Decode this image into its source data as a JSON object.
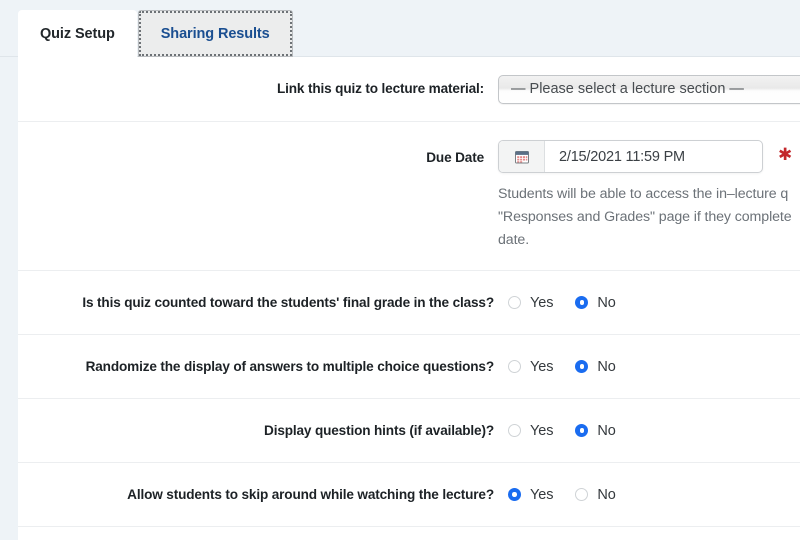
{
  "tabs": [
    {
      "label": "Quiz Setup",
      "active": false
    },
    {
      "label": "Sharing Results",
      "active": true
    }
  ],
  "form": {
    "lecture_link": {
      "label": "Link this quiz to lecture material:",
      "selected_option": "— Please select a lecture section —"
    },
    "due_date": {
      "label": "Due Date",
      "value": "2/15/2021 11:59 PM",
      "placeholder": "",
      "calendar_icon": "calendar-icon",
      "required_marker": "✱",
      "help_text": "Students will be able to access the in–lecture q\n\"Responses and Grades\" page if they complete\ndate."
    },
    "questions": [
      {
        "label": "Is this quiz counted toward the students' final grade in the class?",
        "options": [
          {
            "label": "Yes",
            "checked": false
          },
          {
            "label": "No",
            "checked": true
          }
        ]
      },
      {
        "label": "Randomize the display of answers to multiple choice questions?",
        "options": [
          {
            "label": "Yes",
            "checked": false
          },
          {
            "label": "No",
            "checked": true
          }
        ]
      },
      {
        "label": "Display question hints (if available)?",
        "options": [
          {
            "label": "Yes",
            "checked": false
          },
          {
            "label": "No",
            "checked": true
          }
        ]
      },
      {
        "label": "Allow students to skip around while watching the lecture?",
        "options": [
          {
            "label": "Yes",
            "checked": true
          },
          {
            "label": "No",
            "checked": false
          }
        ]
      }
    ]
  },
  "colors": {
    "page_background": "#eef3f7",
    "card_background": "#ffffff",
    "active_tab_text": "#1b4f91",
    "radio_accent": "#1a6cf0",
    "required_star": "#c3272b",
    "help_text": "#6c7278"
  }
}
